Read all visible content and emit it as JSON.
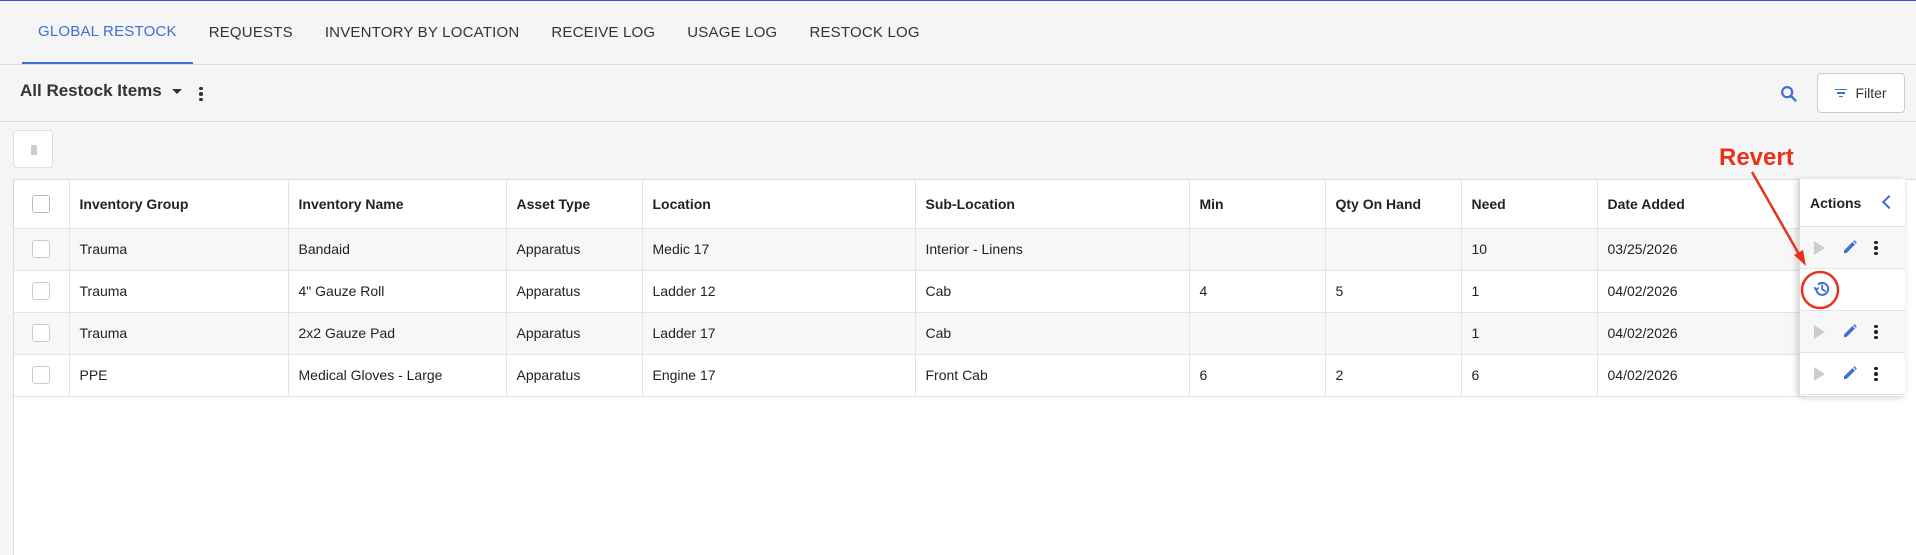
{
  "tabs": [
    {
      "label": "GLOBAL RESTOCK",
      "active": true
    },
    {
      "label": "REQUESTS"
    },
    {
      "label": "INVENTORY BY LOCATION"
    },
    {
      "label": "RECEIVE LOG"
    },
    {
      "label": "USAGE LOG"
    },
    {
      "label": "RESTOCK LOG"
    }
  ],
  "toolbar": {
    "view_title": "All Restock Items",
    "filter_label": "Filter",
    "search_icon": "search-icon",
    "filter_icon": "filter-icon"
  },
  "table": {
    "columns": [
      "Inventory Group",
      "Inventory Name",
      "Asset Type",
      "Location",
      "Sub-Location",
      "Min",
      "Qty On Hand",
      "Need",
      "Date Added"
    ],
    "actions_header": "Actions",
    "rows": [
      {
        "group": "Trauma",
        "name": "Bandaid",
        "asset_type": "Apparatus",
        "location": "Medic 17",
        "sub_location": "Interior - Linens",
        "min": "",
        "qty": "",
        "need": "10",
        "date": "03/25/2026",
        "actions": "standard"
      },
      {
        "group": "Trauma",
        "name": "4\" Gauze Roll",
        "asset_type": "Apparatus",
        "location": "Ladder 12",
        "sub_location": "Cab",
        "min": "4",
        "qty": "5",
        "need": "1",
        "date": "04/02/2026",
        "actions": "revert"
      },
      {
        "group": "Trauma",
        "name": "2x2 Gauze Pad",
        "asset_type": "Apparatus",
        "location": "Ladder 17",
        "sub_location": "Cab",
        "min": "",
        "qty": "",
        "need": "1",
        "date": "04/02/2026",
        "actions": "standard"
      },
      {
        "group": "PPE",
        "name": "Medical Gloves - Large",
        "asset_type": "Apparatus",
        "location": "Engine 17",
        "sub_location": "Front Cab",
        "min": "6",
        "qty": "2",
        "need": "6",
        "date": "04/02/2026",
        "actions": "standard"
      }
    ]
  },
  "annotation": {
    "label": "Revert",
    "color": "#e8321c"
  },
  "colors": {
    "accent": "#3d6fd6",
    "annotation": "#e8321c"
  }
}
